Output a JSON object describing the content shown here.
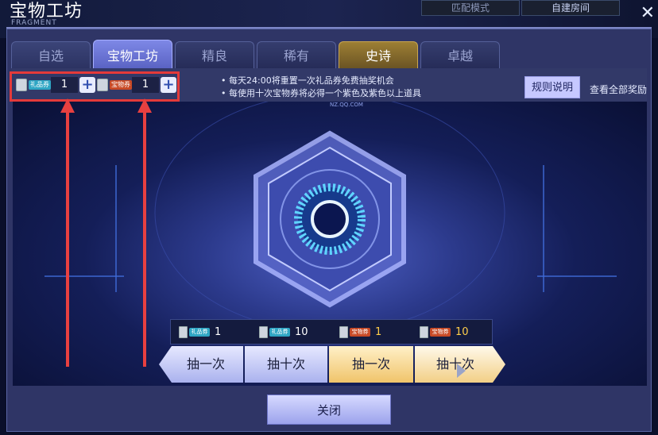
{
  "window": {
    "title": "宝物工坊",
    "subtitle": "FRAGMENT",
    "top_right_buttons": [
      "匹配模式",
      "自建房间"
    ]
  },
  "tabs": [
    {
      "label": "自选",
      "state": "normal"
    },
    {
      "label": "宝物工坊",
      "state": "active"
    },
    {
      "label": "精良",
      "state": "dark"
    },
    {
      "label": "稀有",
      "state": "dark"
    },
    {
      "label": "史诗",
      "state": "gold"
    },
    {
      "label": "卓越",
      "state": "dark"
    }
  ],
  "tickets": [
    {
      "label": "礼品券",
      "count": "1",
      "color": "#2fa6c4",
      "plus": "+"
    },
    {
      "label": "宝物券",
      "count": "1",
      "color": "#c84a26",
      "plus": "+"
    }
  ],
  "notes": [
    "每天24:00将重置一次礼品券免费抽奖机会",
    "每使用十次宝物券将必得一个紫色及紫色以上道具"
  ],
  "rules_button": "规则说明",
  "view_all_rewards": "查看全部奖励",
  "stage_url": "NZ.QQ.COM",
  "costs": [
    {
      "label": "礼品券",
      "num": "1",
      "color": "#2fa6c4",
      "highlight": false
    },
    {
      "label": "礼品券",
      "num": "10",
      "color": "#2fa6c4",
      "highlight": false
    },
    {
      "label": "宝物券",
      "num": "1",
      "color": "#c84a26",
      "highlight": true
    },
    {
      "label": "宝物券",
      "num": "10",
      "color": "#c84a26",
      "highlight": true
    }
  ],
  "draw_buttons": [
    {
      "label": "抽一次",
      "style": "blue"
    },
    {
      "label": "抽十次",
      "style": "blue"
    },
    {
      "label": "抽一次",
      "style": "gold"
    },
    {
      "label": "抽十次",
      "style": "gold"
    }
  ],
  "close_button": "关闭",
  "annotation_color": "#e43a3a"
}
